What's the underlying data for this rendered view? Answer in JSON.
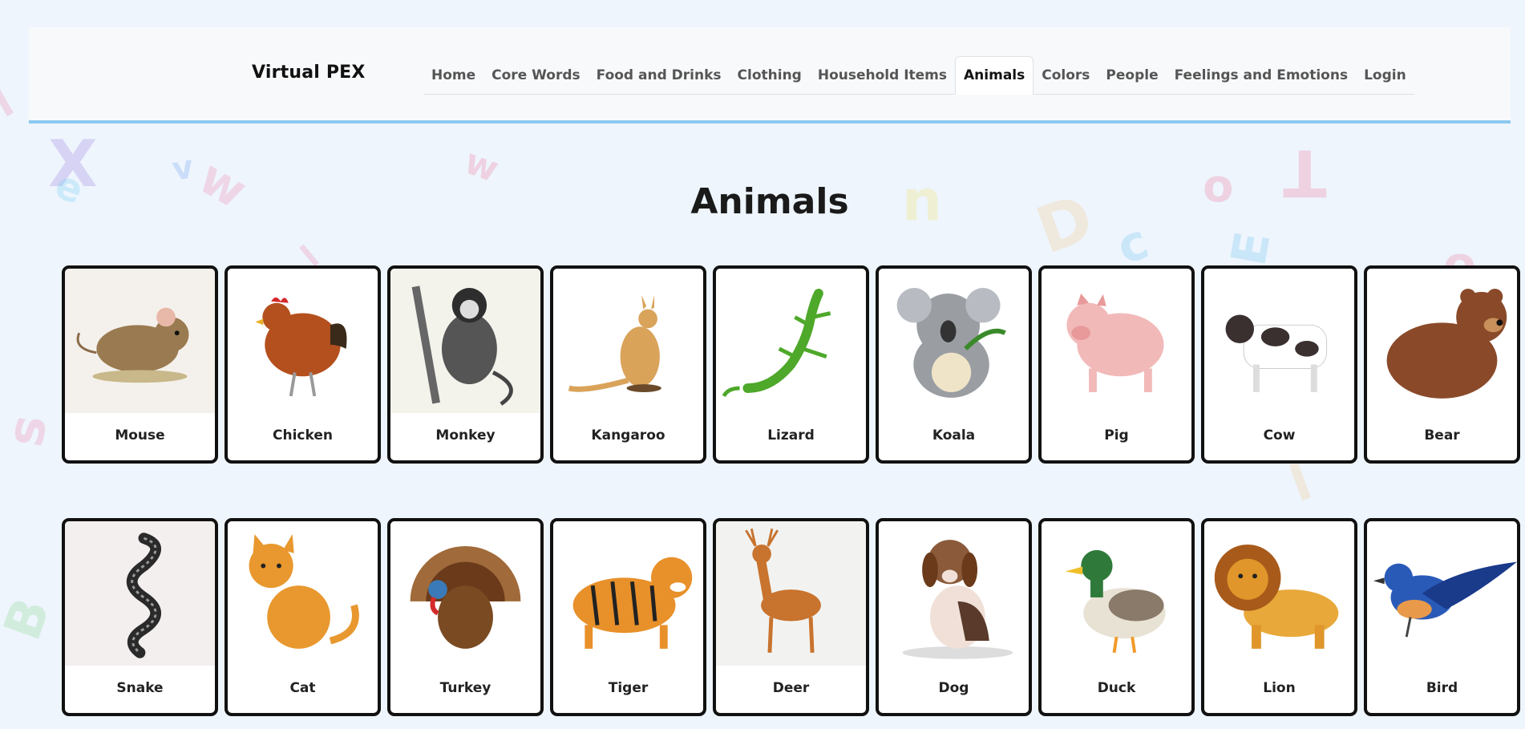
{
  "app": {
    "brand": "Virtual PEX"
  },
  "nav": {
    "items": [
      {
        "label": "Home",
        "active": false
      },
      {
        "label": "Core Words",
        "active": false
      },
      {
        "label": "Food and Drinks",
        "active": false
      },
      {
        "label": "Clothing",
        "active": false
      },
      {
        "label": "Household Items",
        "active": false
      },
      {
        "label": "Animals",
        "active": true
      },
      {
        "label": "Colors",
        "active": false
      },
      {
        "label": "People",
        "active": false
      },
      {
        "label": "Feelings and Emotions",
        "active": false
      },
      {
        "label": "Login",
        "active": false
      }
    ]
  },
  "page": {
    "title": "Animals"
  },
  "cards": [
    {
      "label": "Mouse",
      "icon": "mouse-icon",
      "color": "#9a7a50",
      "bg": "#f4f1ec"
    },
    {
      "label": "Chicken",
      "icon": "chicken-icon",
      "color": "#b4501e",
      "bg": "#ffffff"
    },
    {
      "label": "Monkey",
      "icon": "monkey-icon",
      "color": "#2e2e2e",
      "bg": "#f3f3ec"
    },
    {
      "label": "Kangaroo",
      "icon": "kangaroo-icon",
      "color": "#d9a35a",
      "bg": "#ffffff"
    },
    {
      "label": "Lizard",
      "icon": "lizard-icon",
      "color": "#4ea82a",
      "bg": "#ffffff"
    },
    {
      "label": "Koala",
      "icon": "koala-icon",
      "color": "#9a9ea3",
      "bg": "#ffffff"
    },
    {
      "label": "Pig",
      "icon": "pig-icon",
      "color": "#f2b9b9",
      "bg": "#ffffff"
    },
    {
      "label": "Cow",
      "icon": "cow-icon",
      "color": "#3a3030",
      "bg": "#ffffff"
    },
    {
      "label": "Bear",
      "icon": "bear-icon",
      "color": "#8a4a2a",
      "bg": "#ffffff"
    },
    {
      "label": "Snake",
      "icon": "snake-icon",
      "color": "#2a2a2a",
      "bg": "#f4efef"
    },
    {
      "label": "Cat",
      "icon": "cat-icon",
      "color": "#e8982e",
      "bg": "#ffffff"
    },
    {
      "label": "Turkey",
      "icon": "turkey-icon",
      "color": "#7a4a22",
      "bg": "#ffffff"
    },
    {
      "label": "Tiger",
      "icon": "tiger-icon",
      "color": "#e8902a",
      "bg": "#ffffff"
    },
    {
      "label": "Deer",
      "icon": "deer-icon",
      "color": "#c8732e",
      "bg": "#f2f3f1"
    },
    {
      "label": "Dog",
      "icon": "dog-icon",
      "color": "#8a5a3a",
      "bg": "#ffffff"
    },
    {
      "label": "Duck",
      "icon": "duck-icon",
      "color": "#2f7a3a",
      "bg": "#ffffff"
    },
    {
      "label": "Lion",
      "icon": "lion-icon",
      "color": "#e0962a",
      "bg": "#ffffff"
    },
    {
      "label": "Bird",
      "icon": "bird-icon",
      "color": "#2a5ab8",
      "bg": "#ffffff"
    }
  ],
  "theme": {
    "header_border": "#8cc8f0",
    "page_bg": "#eef5fd"
  }
}
